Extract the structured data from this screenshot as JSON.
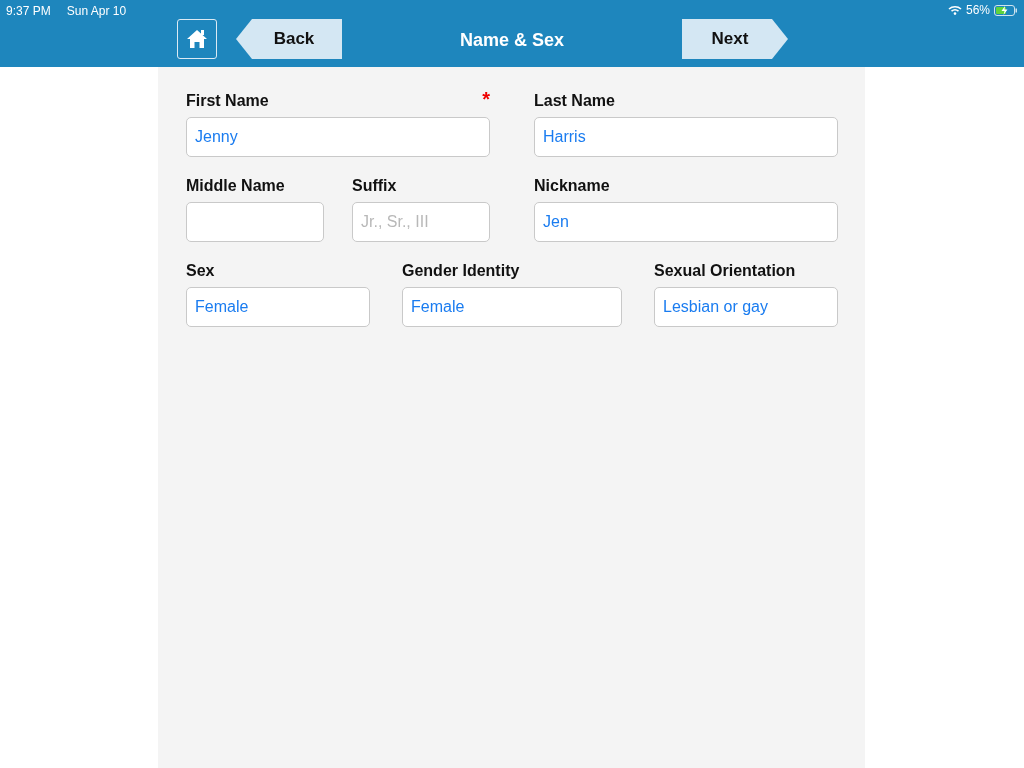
{
  "status_bar": {
    "time": "9:37 PM",
    "date": "Sun Apr 10",
    "battery": "56%"
  },
  "nav_bar": {
    "title": "Name & Sex",
    "back": "Back",
    "next": "Next"
  },
  "form_rows": [
    {
      "fields": [
        {
          "label": "First Name",
          "value": "Jenny",
          "required_mark": "*"
        },
        {
          "label": "Last Name",
          "value": "Harris"
        }
      ]
    },
    {
      "fields": [
        {
          "label": "Middle Name"
        },
        {
          "label": "Suffix",
          "placeholder": "Jr., Sr., III"
        },
        {
          "label": "Nickname",
          "value": "Jen"
        }
      ]
    },
    {
      "fields": [
        {
          "label": "Sex",
          "value": "Female"
        },
        {
          "label": "Gender Identity",
          "value": "Female"
        },
        {
          "label": "Sexual Orientation",
          "value": "Lesbian or gay"
        }
      ]
    }
  ]
}
